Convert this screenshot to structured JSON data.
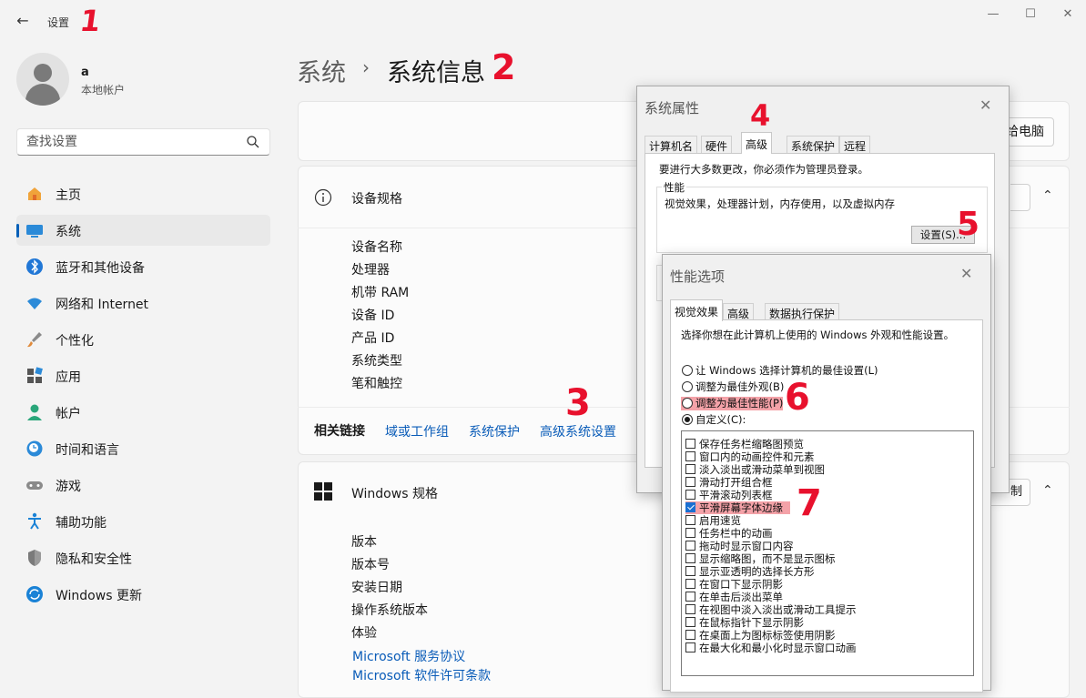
{
  "app": {
    "title": "设置"
  },
  "user": {
    "name": "a",
    "type": "本地帐户"
  },
  "search": {
    "placeholder": "查找设置"
  },
  "sidebar": {
    "items": [
      {
        "label": "主页",
        "icon": "home-icon"
      },
      {
        "label": "系统",
        "icon": "system-icon",
        "active": true
      },
      {
        "label": "蓝牙和其他设备",
        "icon": "bluetooth-icon"
      },
      {
        "label": "网络和 Internet",
        "icon": "wifi-icon"
      },
      {
        "label": "个性化",
        "icon": "brush-icon"
      },
      {
        "label": "应用",
        "icon": "apps-icon"
      },
      {
        "label": "帐户",
        "icon": "account-icon"
      },
      {
        "label": "时间和语言",
        "icon": "clock-globe-icon"
      },
      {
        "label": "游戏",
        "icon": "gamepad-icon"
      },
      {
        "label": "辅助功能",
        "icon": "accessibility-icon"
      },
      {
        "label": "隐私和安全性",
        "icon": "shield-icon"
      },
      {
        "label": "Windows 更新",
        "icon": "update-icon"
      }
    ]
  },
  "breadcrumb": {
    "parent": "系统",
    "current": "系统信息"
  },
  "rename_button": "给电脑",
  "device_specs": {
    "title": "设备规格",
    "rows": [
      "设备名称",
      "处理器",
      "机带 RAM",
      "设备 ID",
      "产品 ID",
      "系统类型",
      "笔和触控"
    ]
  },
  "related_links": {
    "label": "相关链接",
    "links": [
      "域或工作组",
      "系统保护",
      "高级系统设置"
    ]
  },
  "windows_specs": {
    "title": "Windows 规格",
    "copy_button": "制",
    "rows": [
      "版本",
      "版本号",
      "安装日期",
      "操作系统版本",
      "体验"
    ],
    "links": [
      "Microsoft 服务协议",
      "Microsoft 软件许可条款"
    ]
  },
  "sys_props": {
    "title": "系统属性",
    "tabs": [
      "计算机名",
      "硬件",
      "高级",
      "系统保护",
      "远程"
    ],
    "admin_note": "要进行大多数更改，你必须作为管理员登录。",
    "perf_group": "性能",
    "perf_desc": "视觉效果，处理器计划，内存使用，以及虚拟内存",
    "settings_button": "设置(S)..."
  },
  "perf_options": {
    "title": "性能选项",
    "tabs": [
      "视觉效果",
      "高级",
      "数据执行保护"
    ],
    "intro": "选择你想在此计算机上使用的 Windows 外观和性能设置。",
    "radios": [
      {
        "label": "让 Windows 选择计算机的最佳设置(L)",
        "checked": false
      },
      {
        "label": "调整为最佳外观(B)",
        "checked": false
      },
      {
        "label": "调整为最佳性能(P)",
        "checked": false,
        "highlight": true
      },
      {
        "label": "自定义(C):",
        "checked": true
      }
    ],
    "checkboxes": [
      {
        "label": "保存任务栏缩略图预览",
        "checked": false
      },
      {
        "label": "窗口内的动画控件和元素",
        "checked": false
      },
      {
        "label": "淡入淡出或滑动菜单到视图",
        "checked": false
      },
      {
        "label": "滑动打开组合框",
        "checked": false
      },
      {
        "label": "平滑滚动列表框",
        "checked": false
      },
      {
        "label": "平滑屏幕字体边缘",
        "checked": true,
        "highlight": true
      },
      {
        "label": "启用速览",
        "checked": false
      },
      {
        "label": "任务栏中的动画",
        "checked": false
      },
      {
        "label": "拖动时显示窗口内容",
        "checked": false
      },
      {
        "label": "显示缩略图，而不是显示图标",
        "checked": false
      },
      {
        "label": "显示亚透明的选择长方形",
        "checked": false
      },
      {
        "label": "在窗口下显示阴影",
        "checked": false
      },
      {
        "label": "在单击后淡出菜单",
        "checked": false
      },
      {
        "label": "在视图中淡入淡出或滑动工具提示",
        "checked": false
      },
      {
        "label": "在鼠标指针下显示阴影",
        "checked": false
      },
      {
        "label": "在桌面上为图标标签使用阴影",
        "checked": false
      },
      {
        "label": "在最大化和最小化时显示窗口动画",
        "checked": false
      }
    ]
  },
  "annotations": [
    "1",
    "2",
    "3",
    "4",
    "5",
    "6",
    "7"
  ],
  "colors": {
    "accent": "#005fb8",
    "link": "#0a5cb8",
    "annotation": "#e8112d",
    "highlight": "#f4a2a8"
  }
}
